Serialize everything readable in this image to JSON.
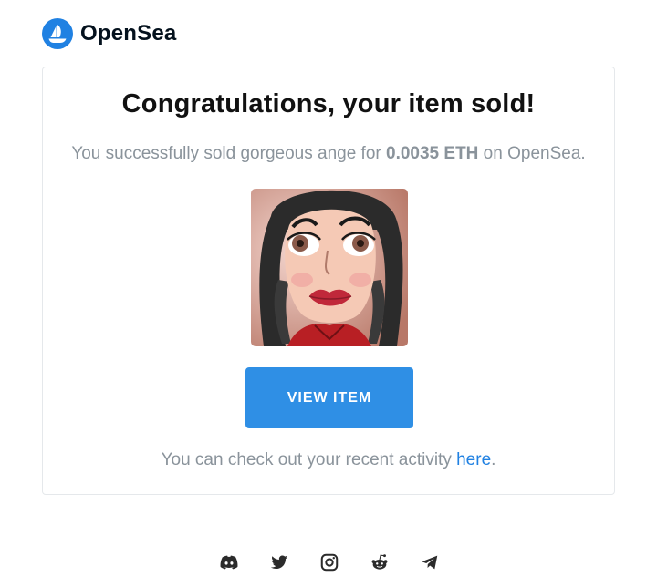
{
  "brand": {
    "name": "OpenSea",
    "color": "#2081e2"
  },
  "card": {
    "title": "Congratulations, your item sold!",
    "subtitle_prefix": "You successfully sold gorgeous ange for ",
    "price": "0.0035 ETH",
    "subtitle_suffix": " on OpenSea.",
    "button_label": "VIEW ITEM",
    "activity_prefix": "You can check out your recent activity ",
    "activity_link": "here",
    "activity_suffix": "."
  },
  "socials": [
    {
      "icon": "discord-icon"
    },
    {
      "icon": "twitter-icon"
    },
    {
      "icon": "instagram-icon"
    },
    {
      "icon": "reddit-icon"
    },
    {
      "icon": "telegram-icon"
    }
  ],
  "colors": {
    "button": "#2f8fe5",
    "link": "#2081e2",
    "muted_text": "#8a939b"
  }
}
